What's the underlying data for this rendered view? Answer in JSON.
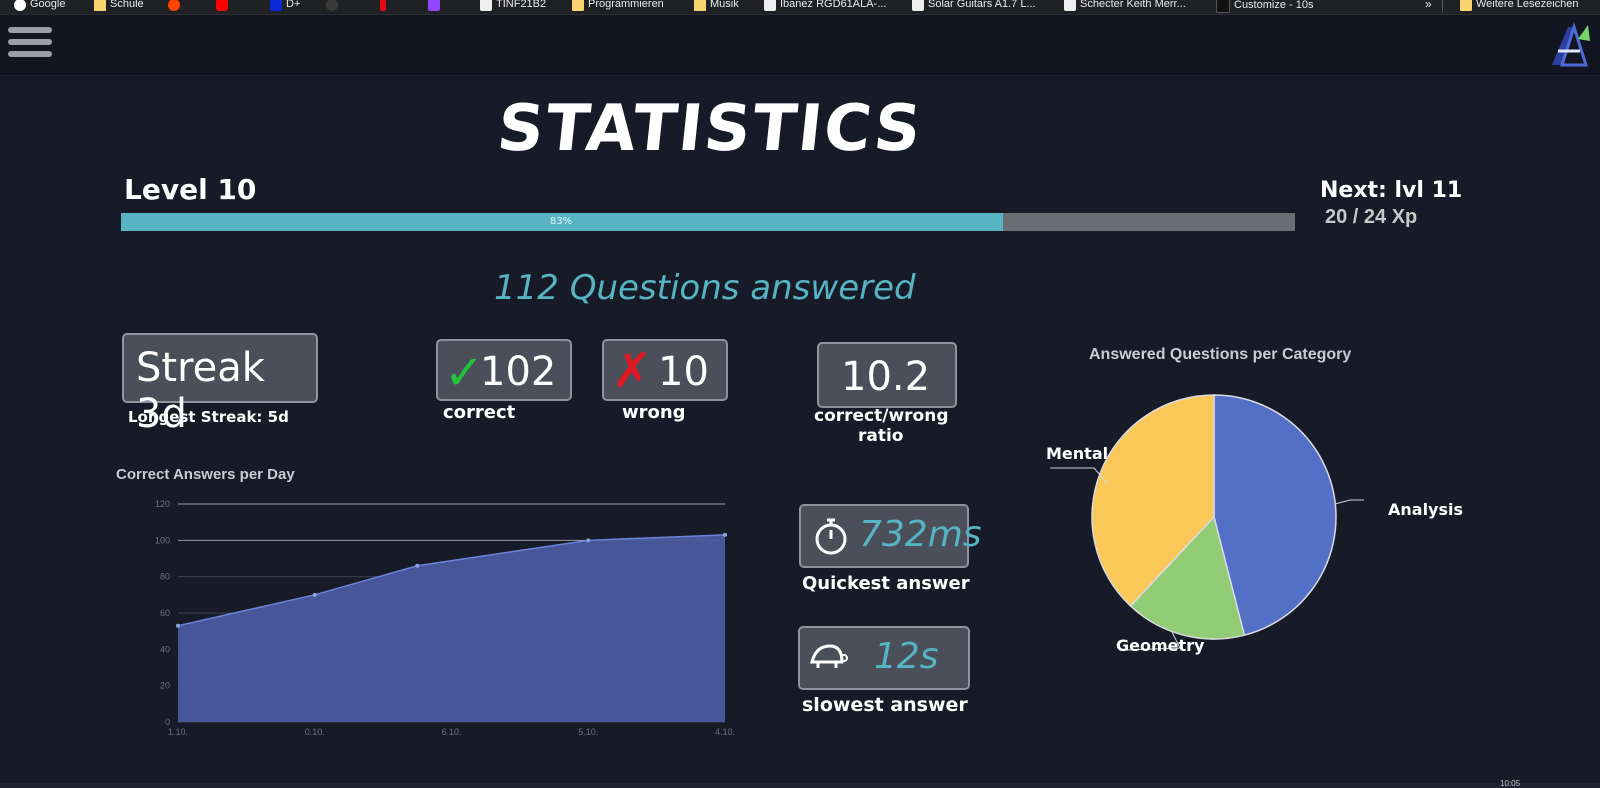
{
  "bookmarks": [
    {
      "label": "Google",
      "icon": "google-icon"
    },
    {
      "label": "Schule",
      "icon": "folder-icon"
    },
    {
      "label": "",
      "icon": "reddit-icon"
    },
    {
      "label": "",
      "icon": "youtube-icon"
    },
    {
      "label": "D+",
      "icon": "disney-plus-icon"
    },
    {
      "label": "",
      "icon": "github-icon"
    },
    {
      "label": "",
      "icon": "netflix-icon"
    },
    {
      "label": "",
      "icon": "twitch-icon"
    },
    {
      "label": "TINF21B2",
      "icon": "page-icon"
    },
    {
      "label": "Programmieren",
      "icon": "folder-icon"
    },
    {
      "label": "Musik",
      "icon": "folder-icon"
    },
    {
      "label": "Ibanez RGD61ALA-...",
      "icon": "page-icon"
    },
    {
      "label": "Solar Guitars A1.7 L...",
      "icon": "page-icon"
    },
    {
      "label": "Schecter Keith Merr...",
      "icon": "page-icon"
    },
    {
      "label": "Customize - 10s",
      "icon": "page-icon"
    }
  ],
  "bookmarks_more": "»",
  "other_bookmarks": "Weitere Lesezeichen",
  "title": "STATISTICS",
  "level": {
    "label": "Level 10",
    "progress_percent": 83,
    "progress_text": "83%",
    "next": "Next: lvl 11",
    "xp": "20 / 24 Xp"
  },
  "answered": "112 Questions answered",
  "streak": {
    "value": "Streak 3d",
    "longest": "Longest Streak: 5d"
  },
  "correct": {
    "value": "102",
    "label": "correct"
  },
  "wrong": {
    "value": "10",
    "label": "wrong"
  },
  "ratio": {
    "value": "10.2",
    "label_line1": "correct/wrong",
    "label_line2": "ratio"
  },
  "quickest": {
    "value": "732ms",
    "label": "Quickest answer"
  },
  "slowest": {
    "value": "12s",
    "label": "slowest answer"
  },
  "clock": "10:05",
  "colors": {
    "accent": "#56b4c3",
    "line_fill": "#4a5a9e",
    "pie_blue": "#5470c6",
    "pie_yellow": "#fac858",
    "pie_green": "#91cc75"
  },
  "chart_data": [
    {
      "type": "area",
      "title": "Correct Answers per Day",
      "categories": [
        "1.10.",
        "0.10.",
        "6.10.",
        "5.10.",
        "4.10."
      ],
      "tick_x": [
        "1.10.",
        "0.10.",
        "6.10.",
        "5.10.",
        "4.10."
      ],
      "x_values": [
        0,
        1,
        2,
        3,
        4
      ],
      "point_x": [
        0,
        1,
        1.75,
        3,
        4
      ],
      "values": [
        53,
        70,
        86,
        100,
        103
      ],
      "ylim": [
        0,
        120
      ],
      "yticks": [
        0,
        20,
        40,
        60,
        80,
        100,
        120
      ],
      "grid": true
    },
    {
      "type": "pie",
      "title": "Answered Questions per Category",
      "slices": [
        {
          "name": "Analysis",
          "value": 46,
          "color": "#5470c6"
        },
        {
          "name": "Geometry",
          "value": 16,
          "color": "#91cc75"
        },
        {
          "name": "Mental",
          "value": 38,
          "color": "#fac858"
        }
      ]
    }
  ]
}
